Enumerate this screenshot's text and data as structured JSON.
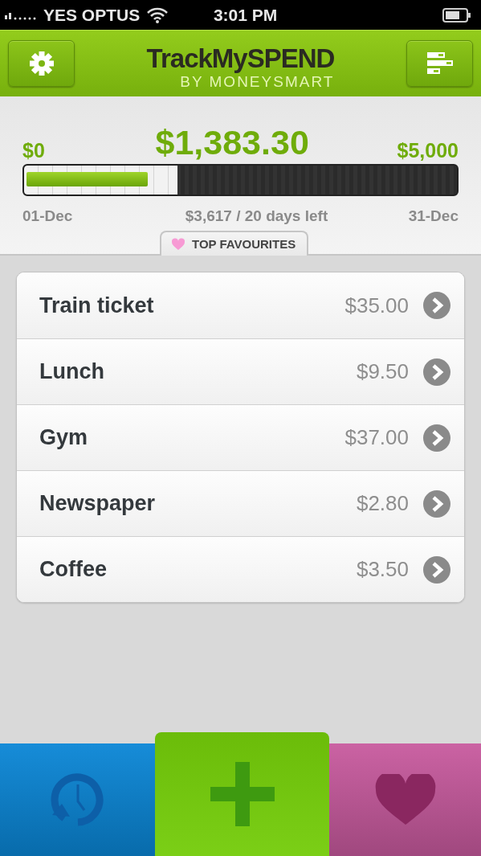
{
  "status_bar": {
    "carrier": "YES OPTUS",
    "time": "3:01 PM"
  },
  "header": {
    "title": "TrackMySPEND",
    "subtitle": "BY MONEYSMART"
  },
  "summary": {
    "min": "$0",
    "total": "$1,383.30",
    "max": "$5,000",
    "spend": {
      "level": 0.285
    },
    "period": {
      "level": 0.355
    },
    "start": "01-Dec",
    "remaining": "$3,617 / 20 days left",
    "end": "31-Dec"
  },
  "section_tab": {
    "label": "TOP FAVOURITES"
  },
  "favourites": [
    {
      "name": "Train ticket",
      "amount": "$35.00"
    },
    {
      "name": "Lunch",
      "amount": "$9.50"
    },
    {
      "name": "Gym",
      "amount": "$37.00"
    },
    {
      "name": "Newspaper",
      "amount": "$2.80"
    },
    {
      "name": "Coffee",
      "amount": "$3.50"
    }
  ],
  "tab_bar": [
    {
      "kind": "history",
      "selected": false,
      "color": "#0a86d6"
    },
    {
      "kind": "add",
      "selected": true,
      "color": "#74cc0a"
    },
    {
      "kind": "favourites",
      "selected": false,
      "color": "#c85a9e"
    }
  ]
}
